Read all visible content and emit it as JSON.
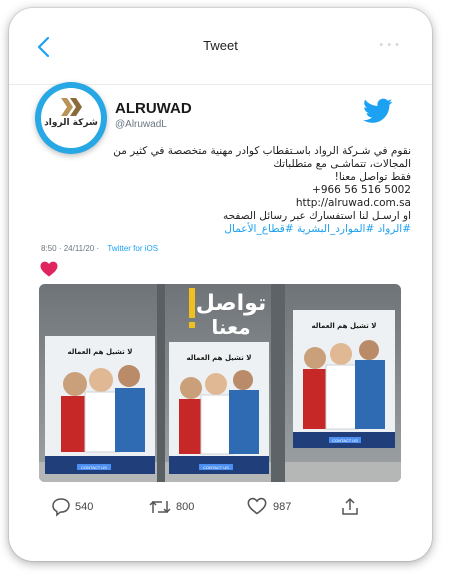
{
  "header": {
    "title": "Tweet",
    "more_label": "•••"
  },
  "account": {
    "name": "ALRUWAD",
    "handle": "@AlruwadL",
    "avatar_text": "شركة الرواد"
  },
  "tweet": {
    "lines": [
      "نقوم في شـركة الرواد باسـتقطاب كوادر مهنية متخصصة في كثير من",
      "المجالات، تتماشـى مع متطلباتك",
      "فقط تواصل معنا!"
    ],
    "phone": "+966 56 516 5002",
    "url": "http://alruwad.com.sa",
    "closing": "او ارسـل لنا استفسارك عبر رسائل الصفحه",
    "hashtags": "#الرواد #الموارد_البشرية #قطاع_الأعمال"
  },
  "meta": {
    "time": "8:50",
    "date": "24/11/20",
    "source": "Twitter for iOS"
  },
  "photo": {
    "banner_line1": "تواصل",
    "banner_line2": "معنا",
    "poster_headline": "لا تشيل هم العماله",
    "poster_button": "CONTACT US"
  },
  "actions": {
    "replies": "540",
    "retweets": "800",
    "likes": "987"
  },
  "colors": {
    "accent": "#1da1f2",
    "liked": "#e0245e",
    "avatar_ring": "#27a7e3"
  },
  "icons": [
    "back-chevron-icon",
    "twitter-bird-icon",
    "heart-icon",
    "reply-icon",
    "retweet-icon",
    "like-icon",
    "share-icon"
  ]
}
